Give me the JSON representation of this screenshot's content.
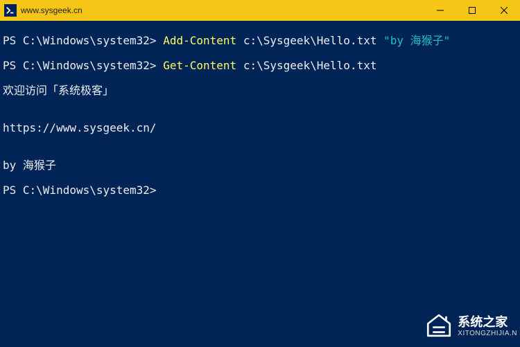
{
  "window": {
    "title": "www.sysgeek.cn"
  },
  "terminal": {
    "prompt": "PS C:\\Windows\\system32>",
    "lines": {
      "line1_cmd": "Add-Content",
      "line1_arg": "c:\\Sysgeek\\Hello.txt",
      "line1_str": "\"by 海猴子\"",
      "line2_cmd": "Get-Content",
      "line2_arg": "c:\\Sysgeek\\Hello.txt",
      "out1": "欢迎访问「系统极客」",
      "out2": "",
      "out3": "https://www.sysgeek.cn/",
      "out4": "",
      "out5": "by 海猴子"
    }
  },
  "watermark": {
    "main": "系统之家",
    "sub": "XITONGZHIJIA.N"
  }
}
